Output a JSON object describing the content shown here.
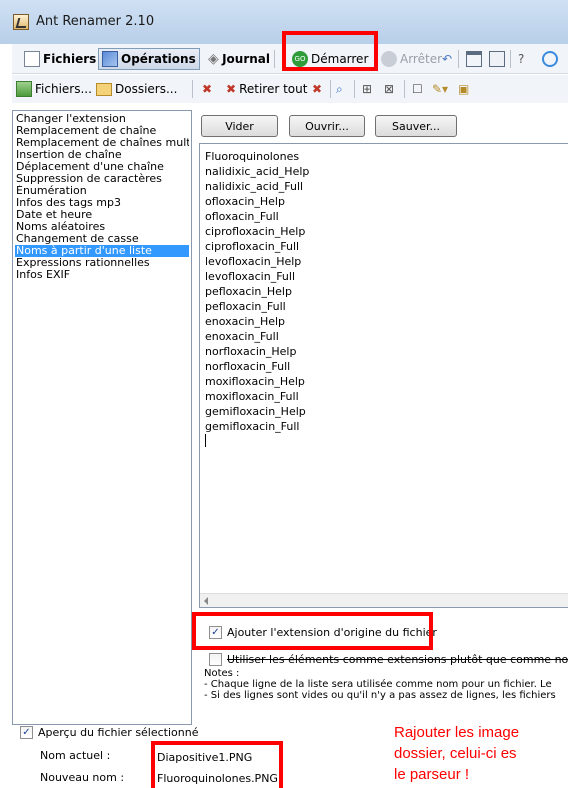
{
  "window": {
    "title": "Ant Renamer 2.10"
  },
  "toolbar": {
    "files_tab": "Fichiers",
    "operations_tab": "Opérations",
    "journal_tab": "Journal",
    "start_button": "Démarrer",
    "stop_button": "Arrêter"
  },
  "toolbar2": {
    "add_files": "Fichiers...",
    "add_folders": "Dossiers...",
    "remove_all": "Retirer tout"
  },
  "operations_list": {
    "items": [
      "Changer l'extension",
      "Remplacement de chaîne",
      "Remplacement de chaînes multiples",
      "Insertion de chaîne",
      "Déplacement d'une chaîne",
      "Suppression de caractères",
      "Énumération",
      "Infos des tags mp3",
      "Date et heure",
      "Noms aléatoires",
      "Changement de casse",
      "Noms à partir d'une liste",
      "Expressions rationnelles",
      "Infos EXIF"
    ],
    "selected_index": 11
  },
  "list_panel": {
    "clear_button": "Vider",
    "open_button": "Ouvrir...",
    "save_button": "Sauver...",
    "lines": [
      "Fluoroquinolones",
      "nalidixic_acid_Help",
      "nalidixic_acid_Full",
      "ofloxacin_Help",
      "ofloxacin_Full",
      "ciprofloxacin_Help",
      "ciprofloxacin_Full",
      "levofloxacin_Help",
      "levofloxacin_Full",
      "pefloxacin_Help",
      "pefloxacin_Full",
      "enoxacin_Help",
      "enoxacin_Full",
      "norfloxacin_Help",
      "norfloxacin_Full",
      "moxifloxacin_Help",
      "moxifloxacin_Full",
      "gemifloxacin_Help",
      "gemifloxacin_Full"
    ],
    "keep_extension_label": "Ajouter l'extension d'origine du fichier",
    "keep_extension_checked": true,
    "use_as_extensions_label": "Utiliser les éléments comme extensions plutôt que comme noms",
    "use_as_extensions_checked": false,
    "notes_title": "Notes :",
    "note_1": "- Chaque ligne de la liste sera utilisée comme nom pour un fichier. Le",
    "note_2": "- Si des lignes sont vides ou qu'il n'y a pas assez de lignes, les fichiers"
  },
  "preview": {
    "checkbox_label": "Aperçu du fichier sélectionné",
    "checked": true,
    "current_name_label": "Nom actuel :",
    "current_name_value": "Diapositive1.PNG",
    "new_name_label": "Nouveau nom :",
    "new_name_value": "Fluoroquinolones.PNG"
  },
  "annotation": {
    "line1": "Rajouter les image",
    "line2": "dossier, celui-ci es",
    "line3": "le parseur !"
  },
  "colors": {
    "highlight": "#ff0000",
    "selection": "#3399ff",
    "start_icon": "#2e9d3a"
  }
}
